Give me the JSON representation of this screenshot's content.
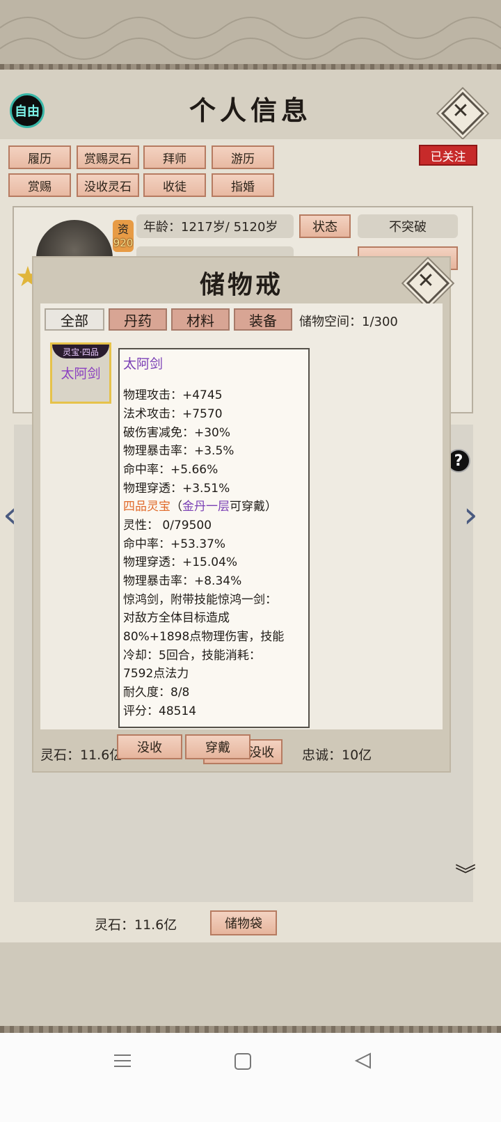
{
  "header": {
    "title": "个人信息",
    "free_label": "自由",
    "close_label": "✕"
  },
  "tags_row1": [
    "履历",
    "赏赐灵石",
    "拜师",
    "游历"
  ],
  "tags_row2": [
    "赏赐",
    "没收灵石",
    "收徒",
    "指婚"
  ],
  "followed_label": "已关注",
  "profile": {
    "badge_char": "资",
    "badge_value": "920",
    "age_text": "年龄：1217岁/ 5120岁",
    "status_button": "状态",
    "breakthrough_label": "不突破"
  },
  "modal": {
    "title": "储物戒",
    "tabs": [
      "全部",
      "丹药",
      "材料",
      "装备"
    ],
    "active_tab": "全部",
    "capacity_text": "储物空间：1/300",
    "item": {
      "grade_badge": "灵宝·四品",
      "name": "太阿剑"
    },
    "tooltip": {
      "name": "太阿剑",
      "stats": [
        "物理攻击：+4745",
        "法术攻击：+7570",
        "破伤害减免：+30%",
        "物理暴击率：+3.5%",
        "命中率：+5.66%",
        "物理穿透：+3.51%"
      ],
      "grade_text": "四品灵宝",
      "req_open": "（",
      "req_realm": "金丹一层",
      "req_close": "可穿戴）",
      "extras": [
        "灵性： 0/79500",
        "命中率：+53.37%",
        "物理穿透：+15.04%",
        "物理暴击率：+8.34%",
        "惊鸿剑，附带技能惊鸿一剑：",
        "对敌方全体目标造成",
        "80%+1898点物理伤害，技能",
        "冷却：5回合，技能消耗：",
        "7592点法力",
        "耐久度：8/8",
        "评分：48514"
      ]
    },
    "confiscate_button": "没收",
    "equip_button": "穿戴",
    "spirit_stone_text": "灵石：11.6亿",
    "under_button": "没收",
    "loyalty_text": "忠诚：10亿"
  },
  "footer": {
    "spirit_stone_text": "灵石：11.6亿",
    "storage_bag_button": "储物袋"
  },
  "colors": {
    "accent_pink": "#e8b9a2",
    "followed_red": "#c72a2a",
    "item_purple": "#7a3fb5",
    "grade_orange": "#e06a2a"
  },
  "icons": {
    "close": "close-icon",
    "left": "arrow-left-icon",
    "right": "arrow-right-icon",
    "help": "help-icon",
    "scroll": "chevron-double-down-icon"
  }
}
